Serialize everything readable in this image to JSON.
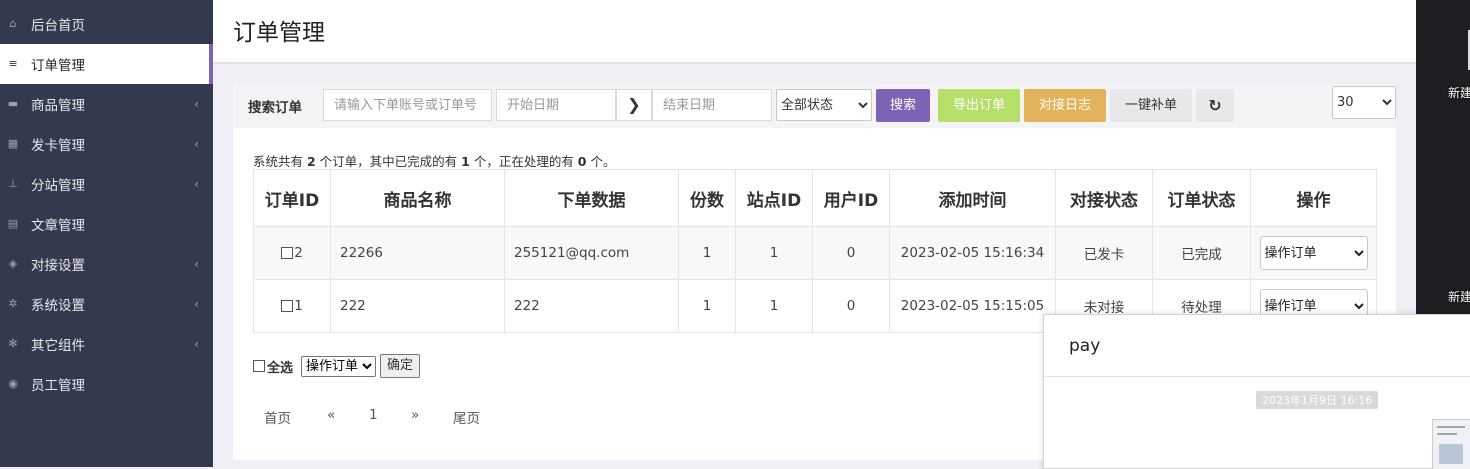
{
  "sidebar": {
    "items": [
      {
        "label": "后台首页",
        "icon": "home-icon",
        "glyph": "⌂",
        "chevron": false,
        "active": false
      },
      {
        "label": "订单管理",
        "icon": "list-icon",
        "glyph": "≡",
        "chevron": false,
        "active": true
      },
      {
        "label": "商品管理",
        "icon": "cart-icon",
        "glyph": "▬",
        "chevron": true,
        "active": false
      },
      {
        "label": "发卡管理",
        "icon": "grid-icon",
        "glyph": "▦",
        "chevron": true,
        "active": false
      },
      {
        "label": "分站管理",
        "icon": "sitemap-icon",
        "glyph": "⊥",
        "chevron": true,
        "active": false
      },
      {
        "label": "文章管理",
        "icon": "book-icon",
        "glyph": "▤",
        "chevron": false,
        "active": false
      },
      {
        "label": "对接设置",
        "icon": "cubes-icon",
        "glyph": "◈",
        "chevron": true,
        "active": false
      },
      {
        "label": "系统设置",
        "icon": "gear-icon",
        "glyph": "✲",
        "chevron": true,
        "active": false
      },
      {
        "label": "其它组件",
        "icon": "cogs-icon",
        "glyph": "✻",
        "chevron": true,
        "active": false
      },
      {
        "label": "员工管理",
        "icon": "user-circle-icon",
        "glyph": "◉",
        "chevron": false,
        "active": false
      }
    ]
  },
  "header": {
    "title": "订单管理"
  },
  "toolbar": {
    "label": "搜索订单",
    "search_placeholder": "请输入下单账号或订单号",
    "start_placeholder": "开始日期",
    "end_placeholder": "结束日期",
    "arrow_glyph": "❯",
    "status_selected": "全部状态",
    "search_btn": "搜索",
    "export_btn": "导出订单",
    "log_btn": "对接日志",
    "refill_btn": "一键补单",
    "refresh_glyph": "↻",
    "page_size": "30"
  },
  "summary": {
    "pre": "系统共有 ",
    "total": "2",
    "mid1": " 个订单，其中已完成的有 ",
    "done": "1",
    "mid2": " 个，正在处理的有 ",
    "pending": "0",
    "post": " 个。"
  },
  "table": {
    "headers": [
      "订单ID",
      "商品名称",
      "下单数据",
      "份数",
      "站点ID",
      "用户ID",
      "添加时间",
      "对接状态",
      "订单状态",
      "操作"
    ],
    "rows": [
      {
        "id": "2",
        "product": "22266",
        "data": "255121@qq.com",
        "qty": "1",
        "site": "1",
        "user": "0",
        "time": "2023-02-05 15:16:34",
        "dock": "已发卡",
        "status": "已完成",
        "op": "操作订单"
      },
      {
        "id": "1",
        "product": "222",
        "data": "222",
        "qty": "1",
        "site": "1",
        "user": "0",
        "time": "2023-02-05 15:15:05",
        "dock": "未对接",
        "status": "待处理",
        "op": "操作订单"
      }
    ]
  },
  "bulk": {
    "select_all": "全选",
    "action": "操作订单",
    "confirm": "确定"
  },
  "pager": {
    "first": "首页",
    "prev": "«",
    "page": "1",
    "next": "»",
    "last": "尾页"
  },
  "desktop": {
    "label1": "新建",
    "label2": "新建"
  },
  "notification": {
    "title": "pay",
    "time": "2023年1月9日 16:16"
  }
}
